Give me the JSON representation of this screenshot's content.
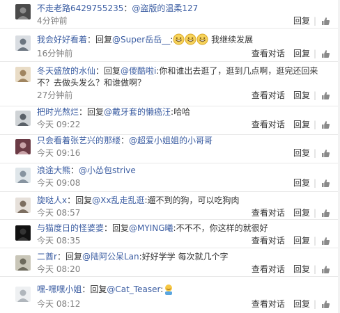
{
  "comments": [
    {
      "user": "不走老路6429755235",
      "segments": [
        {
          "t": "text",
          "v": "："
        },
        {
          "t": "mention",
          "v": "@盗版的温柔127"
        }
      ],
      "time": "4分钟前",
      "actions": [
        "回复"
      ],
      "avatar": {
        "bg": "#4a4a4a",
        "fg": "#8a8a8a"
      }
    },
    {
      "user": "我会好好看着",
      "segments": [
        {
          "t": "text",
          "v": "：回复"
        },
        {
          "t": "mention",
          "v": "@Super岳岳__"
        },
        {
          "t": "text",
          "v": ":"
        },
        {
          "t": "emoji",
          "v": "😄"
        },
        {
          "t": "emoji",
          "v": "😄"
        },
        {
          "t": "emoji",
          "v": "😄"
        },
        {
          "t": "text",
          "v": " 我继续发展"
        }
      ],
      "time": "16分钟前",
      "actions": [
        "查看对话",
        "回复"
      ],
      "avatar": {
        "bg": "#d9dde2",
        "fg": "#6b7580"
      }
    },
    {
      "user": "冬天盛放的水仙",
      "segments": [
        {
          "t": "text",
          "v": "：回复"
        },
        {
          "t": "mention",
          "v": "@傻酷啦i"
        },
        {
          "t": "text",
          "v": ":你和谁出去逛了，逛到几点啊，逛完还回来不？去做头发么？和谁做啊？"
        }
      ],
      "time": "27分钟前",
      "actions": [
        "查看对话",
        "回复"
      ],
      "avatar": {
        "bg": "#e9dcc6",
        "fg": "#a08560"
      }
    },
    {
      "user": "把时光熬烂",
      "segments": [
        {
          "t": "text",
          "v": "：回复"
        },
        {
          "t": "mention",
          "v": "@戴牙套的懒癌汪"
        },
        {
          "t": "text",
          "v": ":哈哈"
        }
      ],
      "time": "今天 09:22",
      "actions": [
        "查看对话",
        "回复"
      ],
      "avatar": {
        "bg": "#cfd3d6",
        "fg": "#5a6168"
      }
    },
    {
      "user": "只会看着张艺兴的那缕",
      "segments": [
        {
          "t": "text",
          "v": "："
        },
        {
          "t": "mention",
          "v": "@超爱小姐姐的小哥哥"
        }
      ],
      "time": "今天 09:16",
      "actions": [
        "回复"
      ],
      "avatar": {
        "bg": "#6b3b45",
        "fg": "#c9a3a8"
      }
    },
    {
      "user": "浪途大熊",
      "segments": [
        {
          "t": "text",
          "v": "："
        },
        {
          "t": "mention",
          "v": "@小怂包strive"
        }
      ],
      "time": "今天 09:08",
      "actions": [
        "回复"
      ],
      "avatar": {
        "bg": "#dfe6ea",
        "fg": "#8794a0"
      }
    },
    {
      "user": "旋哒人x",
      "segments": [
        {
          "t": "text",
          "v": "：回复"
        },
        {
          "t": "mention",
          "v": "@Xx乱走乱逛"
        },
        {
          "t": "text",
          "v": ":遛不到的狗，可以吃狗肉"
        }
      ],
      "time": "今天 08:57",
      "actions": [
        "查看对话",
        "回复"
      ],
      "avatar": {
        "bg": "#e6e0da",
        "fg": "#7c6e60"
      }
    },
    {
      "user": "与猫度日的怪婆婆",
      "segments": [
        {
          "t": "text",
          "v": "：回复"
        },
        {
          "t": "mention",
          "v": "@MYING曦"
        },
        {
          "t": "text",
          "v": ":不不不，你这样的就很好"
        }
      ],
      "time": "今天 08:35",
      "actions": [
        "查看对话",
        "回复"
      ],
      "avatar": {
        "bg": "#111111",
        "fg": "#333333"
      }
    },
    {
      "user": "二酋r",
      "segments": [
        {
          "t": "text",
          "v": "：回复"
        },
        {
          "t": "mention",
          "v": "@陆阿公呆Lan"
        },
        {
          "t": "text",
          "v": ":好好学学 每次就几个字"
        }
      ],
      "time": "今天 08:20",
      "actions": [
        "查看对话",
        "回复"
      ],
      "avatar": {
        "bg": "#c9c6b8",
        "fg": "#6d6a5c"
      }
    },
    {
      "user": "嘿-嘿嘿小姐",
      "segments": [
        {
          "t": "text",
          "v": "：回复"
        },
        {
          "t": "mention",
          "v": "@Cat_Teaser"
        },
        {
          "t": "text",
          "v": ":"
        },
        {
          "t": "emoji",
          "v": "🤦"
        }
      ],
      "time": "今天 08:12",
      "actions": [
        "查看对话",
        "回复"
      ],
      "avatar": {
        "bg": "#eef0f2",
        "fg": "#b0b6bc"
      }
    }
  ],
  "colors": {
    "link": "#3b5da2",
    "time": "#808080",
    "divider": "#e8e8e8"
  },
  "icons": {
    "like": "thumbs-up-icon"
  }
}
